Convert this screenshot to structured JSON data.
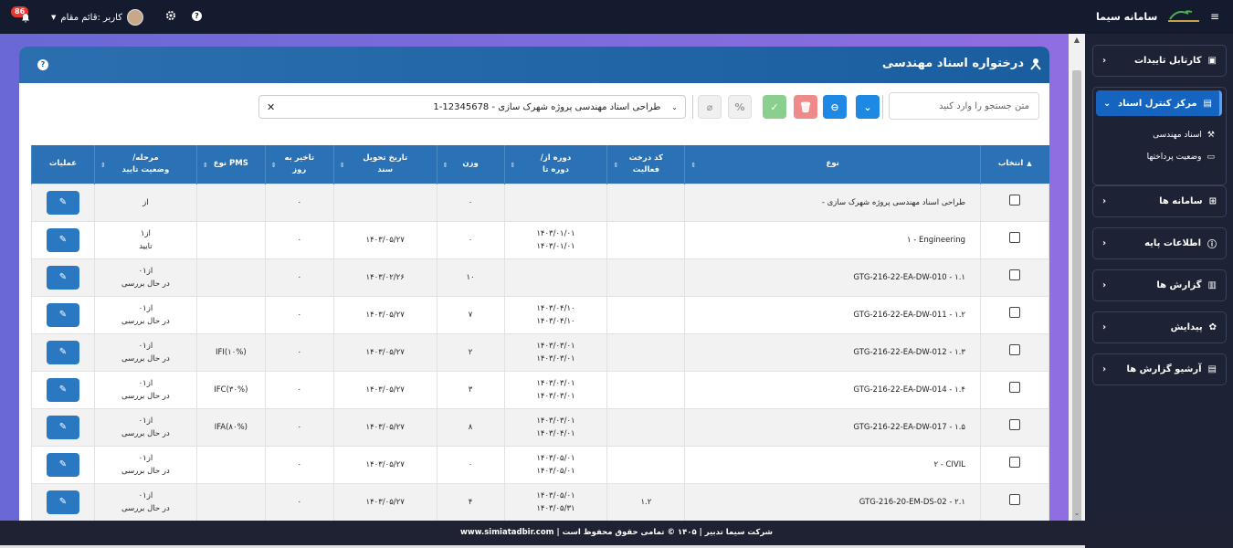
{
  "topbar": {
    "app_name": "سامانه سیما",
    "notif_count": "86",
    "user_label": "کاربر :قائم مقام"
  },
  "card": {
    "title": "درختواره اسناد مهندسی"
  },
  "toolbar": {
    "search_placeholder": "متن جستجو را وارد کنید",
    "project_value": "1-12345678 - طراحی اسناد مهندسی پروژه شهرک سازی"
  },
  "table": {
    "headers": [
      "انتخاب",
      "نوع",
      "کد درخت فعالیت",
      "دوره از/ دوره تا",
      "وزن",
      "تاریخ تحویل سند",
      "تاخیر به روز",
      "نوع PMS",
      "مرحله/ وضعیت تایید",
      "عملیات"
    ],
    "rows": [
      {
        "type": "- طراحی اسناد مهندسی پروژه شهرک سازی",
        "code": "",
        "period": "",
        "weight": "۰",
        "date": "",
        "delay": "۰",
        "pms": "",
        "status": "از"
      },
      {
        "type": "۱ - Engineering",
        "code": "",
        "period": "۱۴۰۳/۰۱/۰۱\n۱۴۰۳/۰۱/۰۱",
        "weight": "۰",
        "date": "۱۴۰۳/۰۵/۲۷",
        "delay": "۰",
        "pms": "",
        "status": "از۱\nتایید"
      },
      {
        "type": "GTG-216-22-EA-DW-010 - ۱.۱",
        "code": "",
        "period": "",
        "weight": "۱۰",
        "date": "۱۴۰۳/۰۲/۲۶",
        "delay": "۰",
        "pms": "",
        "status": "۰از۱\nدر حال بررسی"
      },
      {
        "type": "GTG-216-22-EA-DW-011 - ۱.۲",
        "code": "",
        "period": "۱۴۰۳/۰۴/۱۰\n۱۴۰۳/۰۴/۱۰",
        "weight": "۷",
        "date": "۱۴۰۳/۰۵/۲۷",
        "delay": "۰",
        "pms": "",
        "status": "۰از۱\nدر حال بررسی"
      },
      {
        "type": "GTG-216-22-EA-DW-012 - ۱.۳",
        "code": "",
        "period": "۱۴۰۳/۰۳/۰۱\n۱۴۰۳/۰۳/۰۱",
        "weight": "۲",
        "date": "۱۴۰۳/۰۵/۲۷",
        "delay": "۰",
        "pms": "IFI(۱۰%)",
        "status": "۰از۱\nدر حال بررسی"
      },
      {
        "type": "GTG-216-22-EA-DW-014 - ۱.۴",
        "code": "",
        "period": "۱۴۰۳/۰۳/۰۱\n۱۴۰۳/۰۳/۰۱",
        "weight": "۳",
        "date": "۱۴۰۳/۰۵/۲۷",
        "delay": "۰",
        "pms": "IFC(۳۰%)",
        "status": "۰از۱\nدر حال بررسی"
      },
      {
        "type": "GTG-216-22-EA-DW-017 - ۱.۵",
        "code": "",
        "period": "۱۴۰۳/۰۳/۰۱\n۱۴۰۳/۰۴/۰۱",
        "weight": "۸",
        "date": "۱۴۰۳/۰۵/۲۷",
        "delay": "۰",
        "pms": "IFA(۸۰%)",
        "status": "۰از۱\nدر حال بررسی"
      },
      {
        "type": "۲ - CIVIL",
        "code": "",
        "period": "۱۴۰۳/۰۵/۰۱\n۱۴۰۳/۰۵/۰۱",
        "weight": "۰",
        "date": "۱۴۰۳/۰۵/۲۷",
        "delay": "۰",
        "pms": "",
        "status": "۰از۱\nدر حال بررسی"
      },
      {
        "type": "GTG-216-20-EM-DS-02 - ۲.۱",
        "code": "۱.۲",
        "period": "۱۴۰۳/۰۵/۰۱\n۱۴۰۳/۰۵/۳۱",
        "weight": "۴",
        "date": "۱۴۰۳/۰۵/۲۷",
        "delay": "۰",
        "pms": "",
        "status": "۰از۱\nدر حال بررسی"
      }
    ]
  },
  "sidebar": {
    "items": [
      {
        "label": "کارتابل تاییدات",
        "icon": "clipboard-check-icon"
      },
      {
        "label": "مرکز کنترل اسناد",
        "icon": "archive-icon"
      },
      {
        "label": "سامانه ها",
        "icon": "grid-icon"
      },
      {
        "label": "اطلاعات پایه",
        "icon": "info-icon"
      },
      {
        "label": "گزارش ها",
        "icon": "chart-icon"
      },
      {
        "label": "پیدایش",
        "icon": "sprout-icon"
      },
      {
        "label": "آرشیو گزارش ها",
        "icon": "archive-icon"
      }
    ],
    "subitems": [
      {
        "label": "اسناد مهندسی",
        "icon": "engineering-icon"
      },
      {
        "label": "وضعیت پرداختها",
        "icon": "payment-icon"
      }
    ]
  },
  "footer": {
    "text": "www.simiatadbir.com | شرکت سیما تدبیر | ۱۴۰۵ © تمامی حقوق محفوظ است"
  },
  "colors": {
    "primary": "#2a72b5",
    "teal": "#1565c0",
    "green": "#66bb6a",
    "red": "#ef8a8a",
    "blue": "#1e88e5"
  }
}
